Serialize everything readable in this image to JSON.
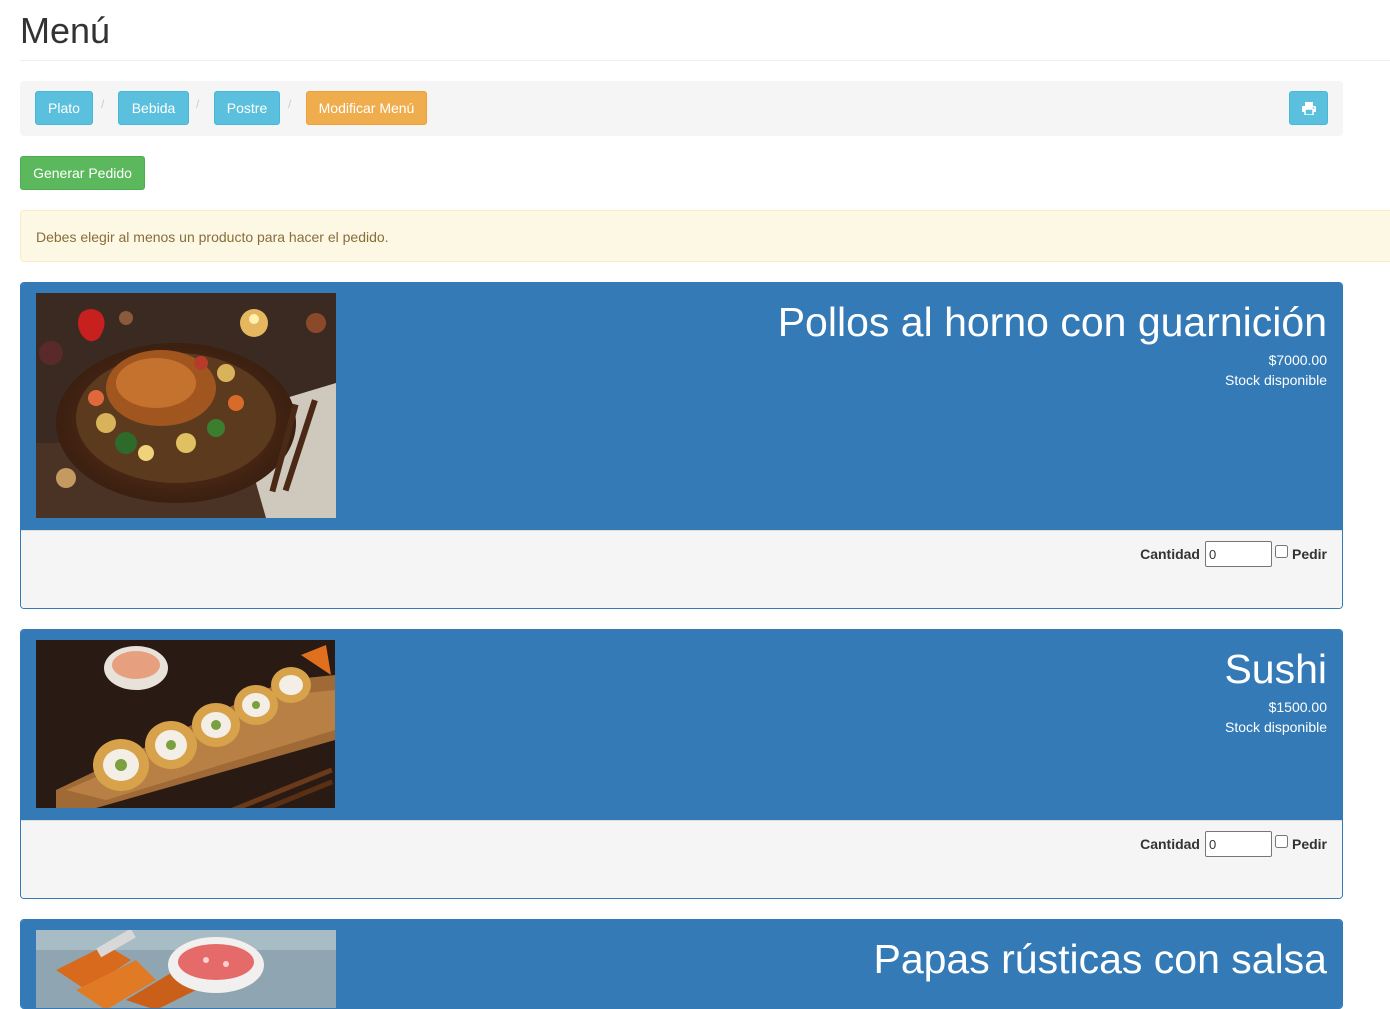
{
  "header": {
    "title": "Menú"
  },
  "toolbar": {
    "items": [
      {
        "label": "Plato"
      },
      {
        "label": "Bebida"
      },
      {
        "label": "Postre"
      },
      {
        "label": "Modificar Menú"
      }
    ],
    "separator": "/",
    "print_icon": "printer-icon"
  },
  "actions": {
    "generate_order": "Generar Pedido"
  },
  "alert": {
    "message": "Debes elegir al menos un producto para hacer el pedido."
  },
  "products": [
    {
      "name": "Pollos al horno con guarnición",
      "price": "$7000.00",
      "stock": "Stock disponible",
      "qty_label": "Cantidad",
      "qty_value": "0",
      "order_label": "Pedir"
    },
    {
      "name": "Sushi",
      "price": "$1500.00",
      "stock": "Stock disponible",
      "qty_label": "Cantidad",
      "qty_value": "0",
      "order_label": "Pedir"
    },
    {
      "name": "Papas rústicas con salsa"
    }
  ],
  "colors": {
    "primary": "#337ab7",
    "info": "#5bc0de",
    "warning": "#f0ad4e",
    "success": "#5cb85c",
    "alert_bg": "#fcf8e3",
    "alert_text": "#8a6d3b"
  }
}
